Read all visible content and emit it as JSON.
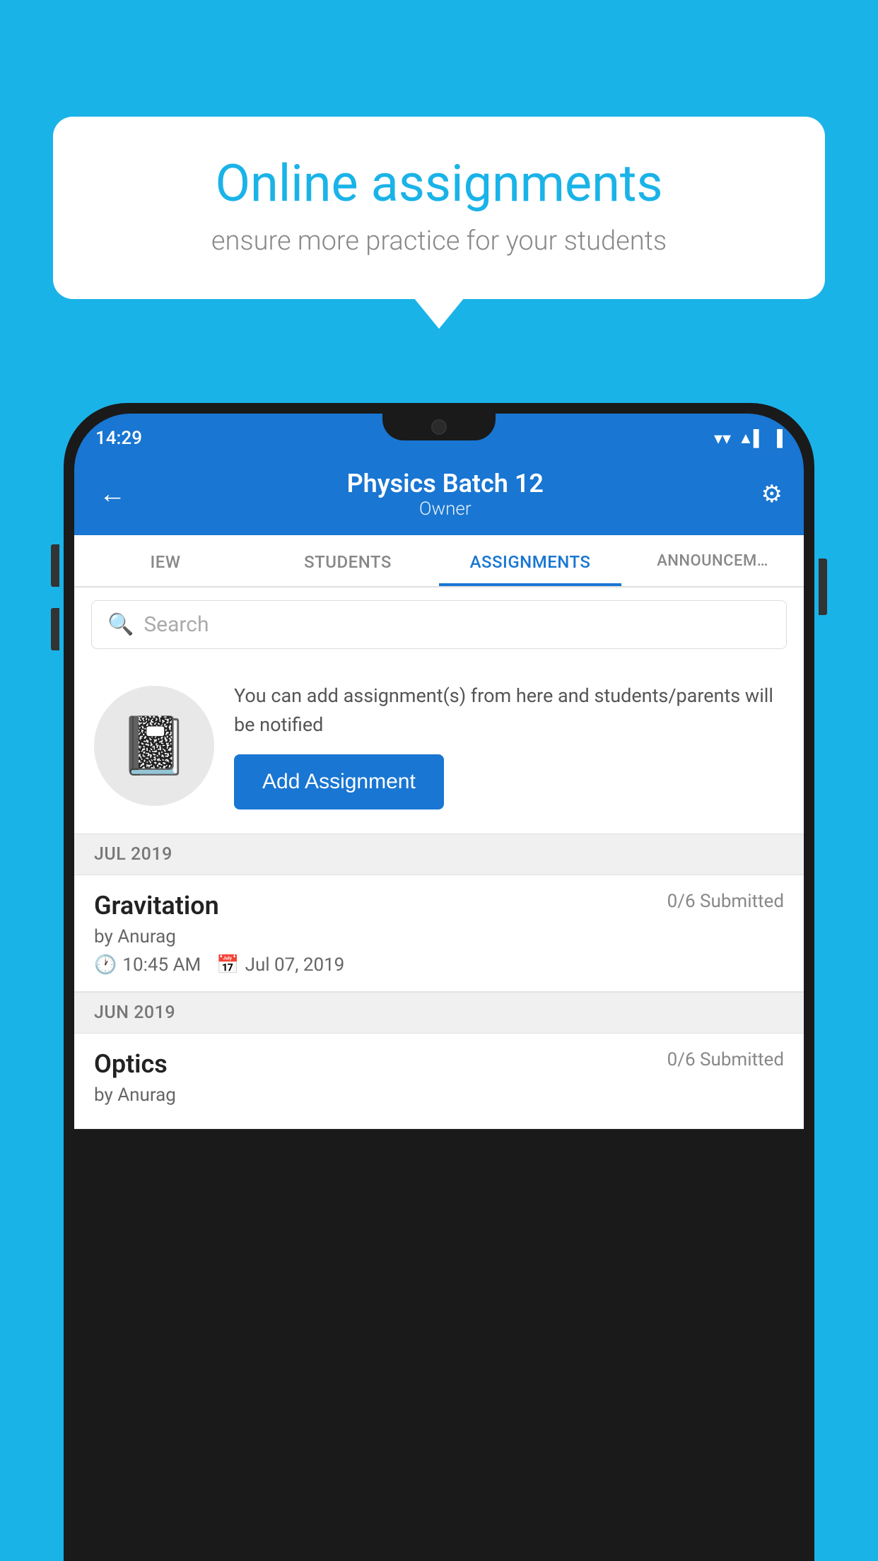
{
  "background_color": "#1ab3e8",
  "speech_bubble": {
    "title": "Online assignments",
    "subtitle": "ensure more practice for your students"
  },
  "phone": {
    "status_bar": {
      "time": "14:29",
      "wifi": "▼",
      "signal": "▲",
      "battery": "▮"
    },
    "header": {
      "title": "Physics Batch 12",
      "subtitle": "Owner",
      "back_label": "←",
      "settings_label": "⚙"
    },
    "tabs": [
      {
        "label": "IEW",
        "active": false
      },
      {
        "label": "STUDENTS",
        "active": false
      },
      {
        "label": "ASSIGNMENTS",
        "active": true
      },
      {
        "label": "ANNOUNCEM...",
        "active": false
      }
    ],
    "search": {
      "placeholder": "Search"
    },
    "info_section": {
      "description": "You can add assignment(s) from here and students/parents will be notified",
      "add_button_label": "Add Assignment"
    },
    "sections": [
      {
        "month_label": "JUL 2019",
        "assignments": [
          {
            "name": "Gravitation",
            "submitted": "0/6 Submitted",
            "by": "by Anurag",
            "time": "10:45 AM",
            "date": "Jul 07, 2019"
          }
        ]
      },
      {
        "month_label": "JUN 2019",
        "assignments": [
          {
            "name": "Optics",
            "submitted": "0/6 Submitted",
            "by": "by Anurag",
            "time": "",
            "date": ""
          }
        ]
      }
    ]
  }
}
